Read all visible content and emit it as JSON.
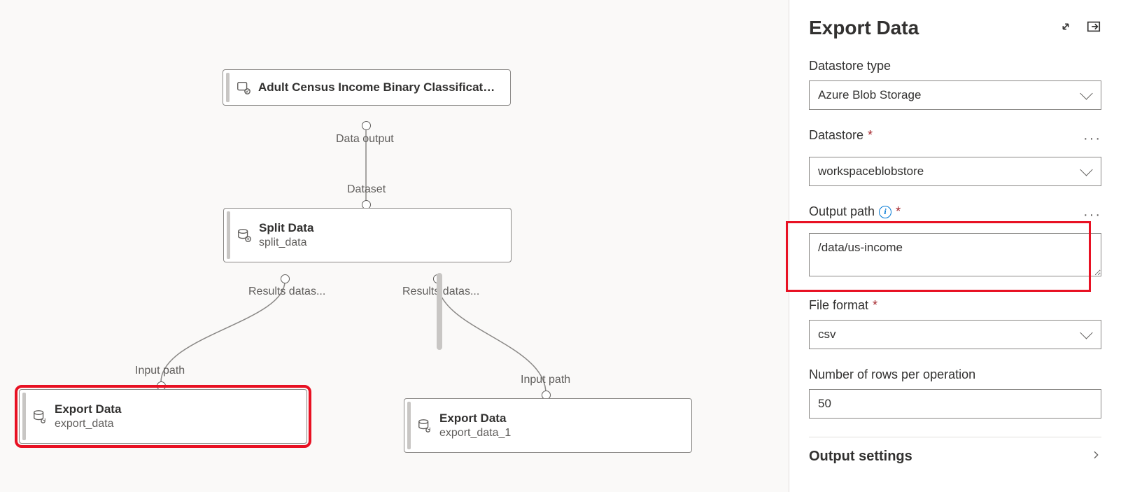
{
  "panel": {
    "title": "Export Data",
    "datastore_type_label": "Datastore type",
    "datastore_type_value": "Azure Blob Storage",
    "datastore_label": "Datastore",
    "datastore_value": "workspaceblobstore",
    "output_path_label": "Output path",
    "output_path_value": "/data/us-income",
    "file_format_label": "File format",
    "file_format_value": "csv",
    "rows_label": "Number of rows per operation",
    "rows_value": "50",
    "output_settings_label": "Output settings"
  },
  "nodes": {
    "dataset": {
      "title": "Adult Census Income Binary Classificatio..."
    },
    "split": {
      "title": "Split Data",
      "sub": "split_data"
    },
    "export1": {
      "title": "Export Data",
      "sub": "export_data"
    },
    "export2": {
      "title": "Export Data",
      "sub": "export_data_1"
    }
  },
  "ports": {
    "data_output": "Data output",
    "dataset": "Dataset",
    "results1": "Results datas...",
    "results2": "Results datas...",
    "input_path1": "Input path",
    "input_path2": "Input path"
  }
}
